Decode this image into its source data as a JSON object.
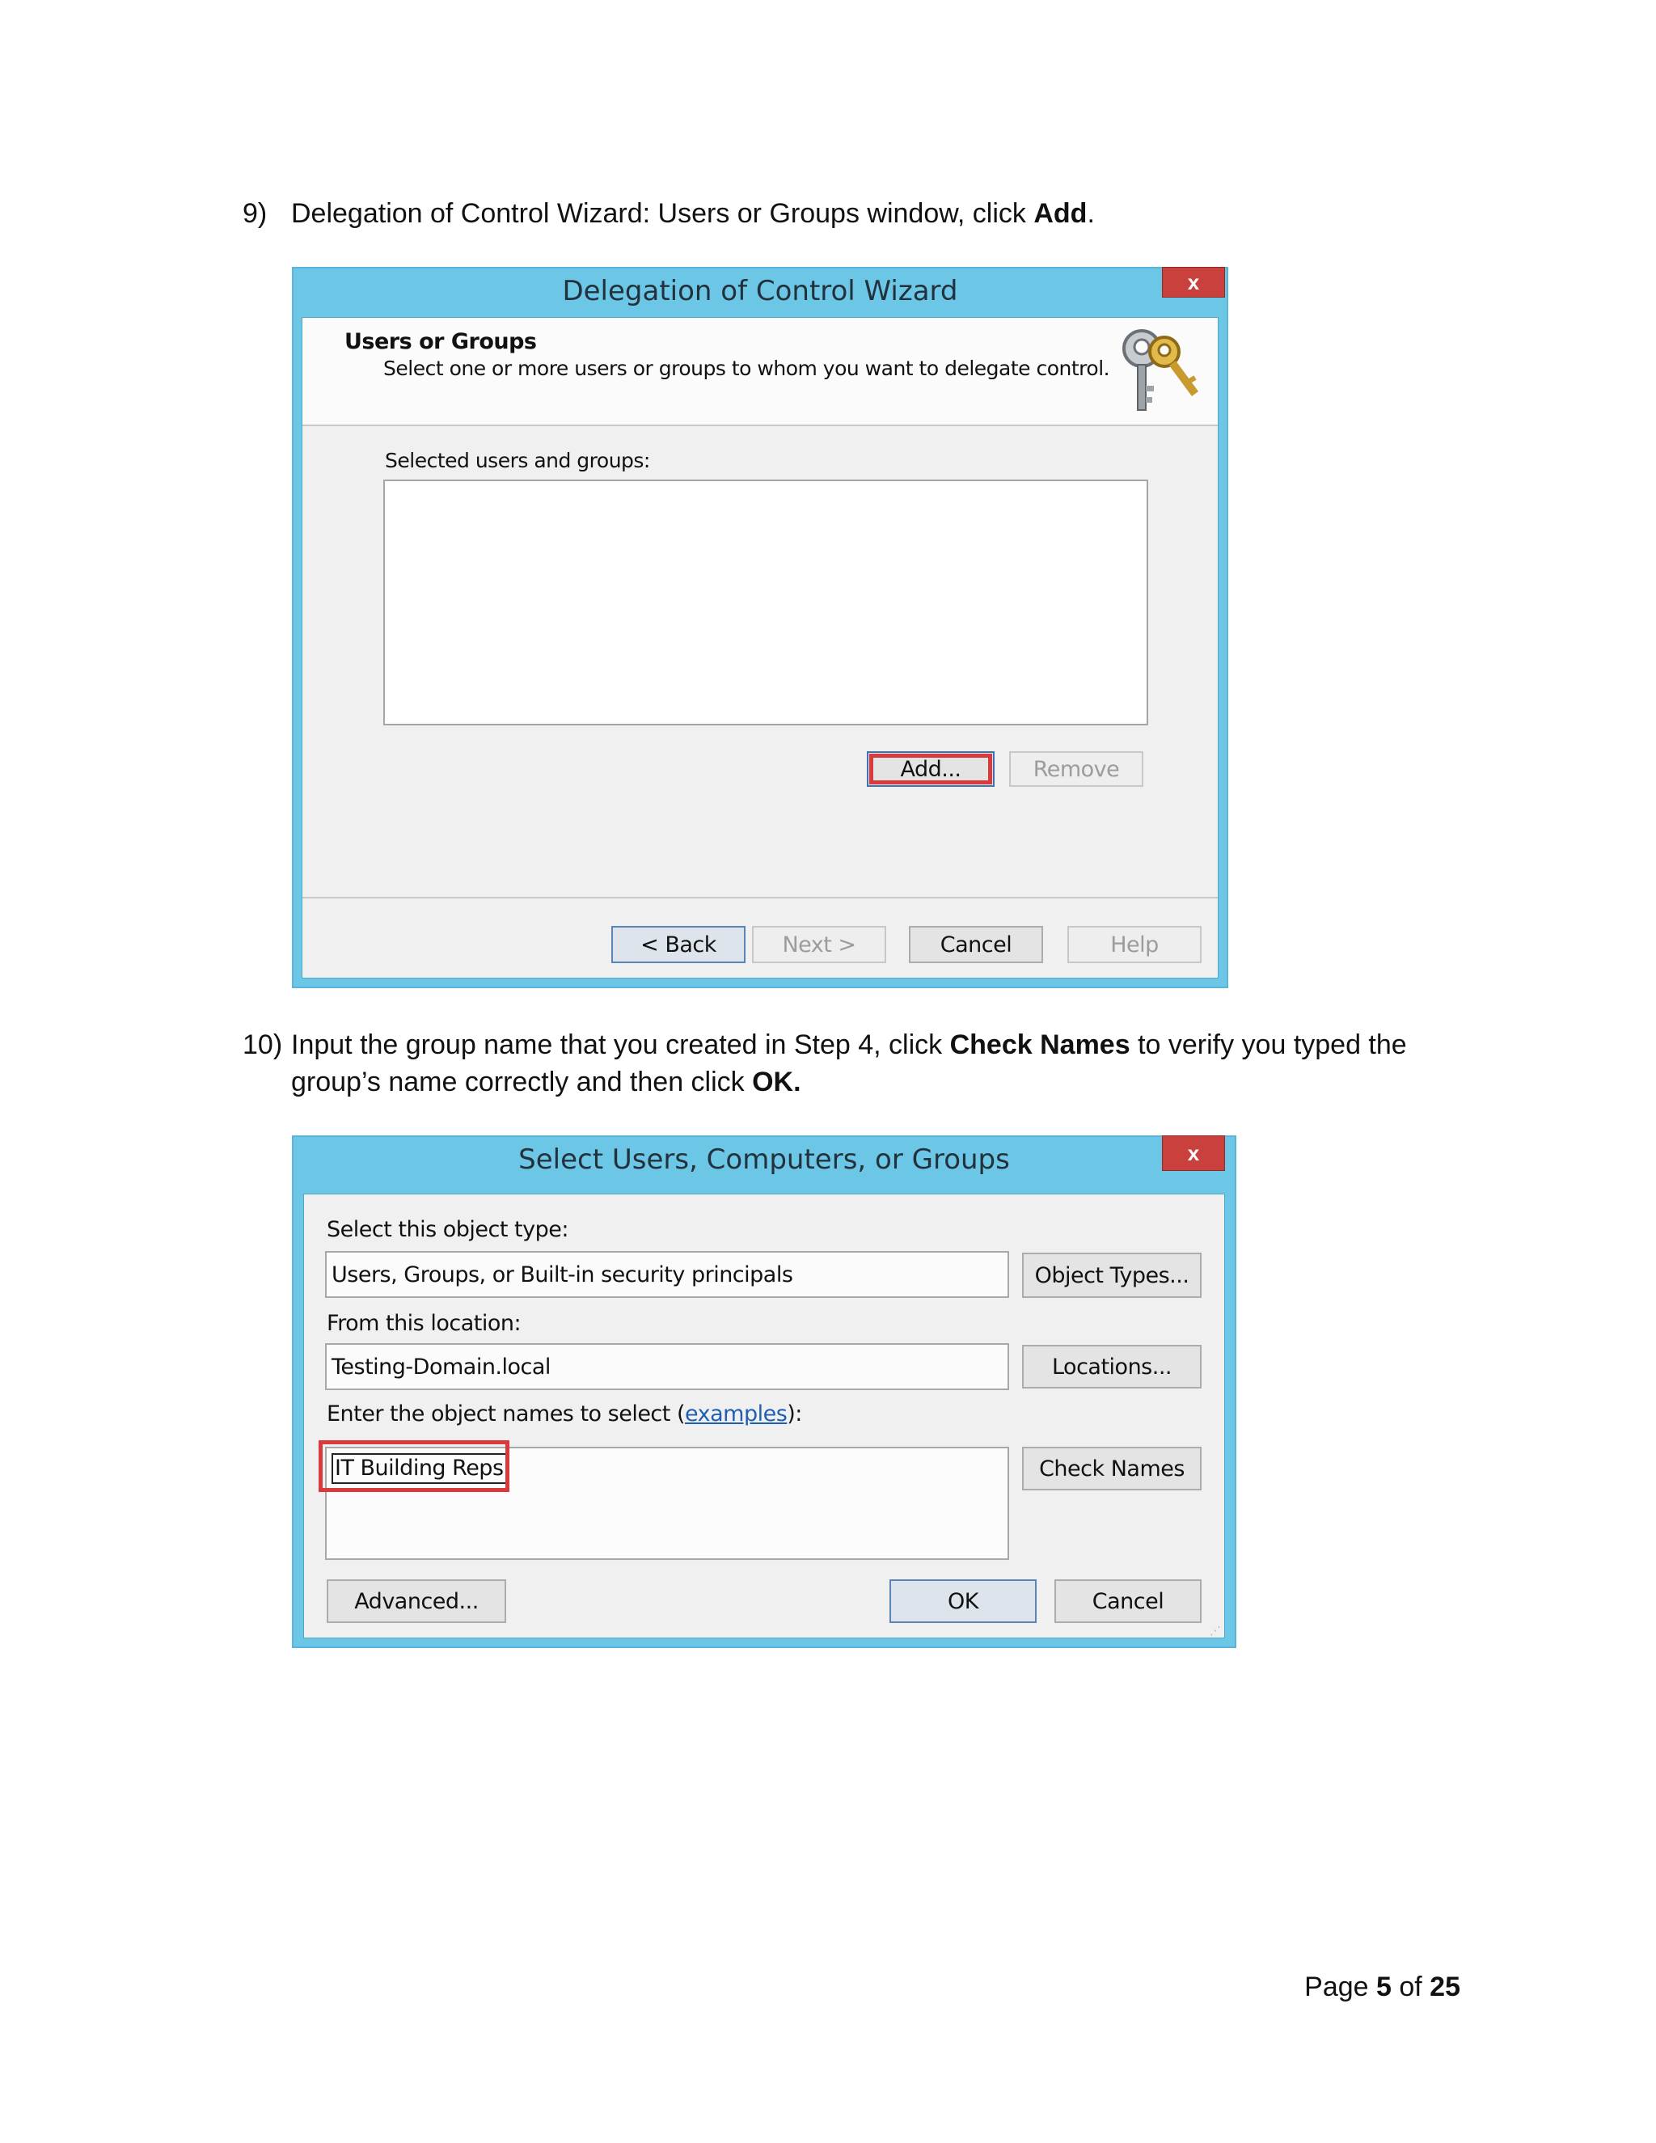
{
  "step9": {
    "number": "9)",
    "text_before": "Delegation of Control Wizard: Users or Groups window, click ",
    "bold": "Add",
    "text_after": "."
  },
  "wizard": {
    "title": "Delegation of Control Wizard",
    "close": "x",
    "heading": "Users or Groups",
    "subheading": "Select one or more users or groups to whom you want to delegate control.",
    "header_icon": "keys-icon",
    "list_label": "Selected users and groups:",
    "add": "Add...",
    "remove": "Remove",
    "back": "< Back",
    "next": "Next >",
    "cancel": "Cancel",
    "help": "Help"
  },
  "step10": {
    "number": "10)",
    "line1_before": "Input the group name that you created in Step 4, click ",
    "line1_bold": "Check Names",
    "line1_after": " to verify you typed the",
    "line2_before": "group’s name correctly and then click ",
    "line2_bold": "OK."
  },
  "select_dialog": {
    "title": "Select Users, Computers, or Groups",
    "close": "x",
    "object_type_label": "Select this object type:",
    "object_type_value": "Users, Groups, or Built-in security principals",
    "object_types_button": "Object Types...",
    "location_label": "From this location:",
    "location_value": "Testing-Domain.local",
    "locations_button": "Locations...",
    "names_label": "Enter the object names to select (",
    "names_link": "examples",
    "names_label_end": "):",
    "names_value": "IT Building Reps",
    "check_names": "Check Names",
    "advanced": "Advanced...",
    "ok": "OK",
    "cancel": "Cancel"
  },
  "footer": {
    "page_prefix": "Page ",
    "page_number": "5",
    "of": " of ",
    "page_total": "25"
  },
  "colors": {
    "frame": "#6cc7e6",
    "highlight": "#d83a3e",
    "close": "#c9403d"
  }
}
